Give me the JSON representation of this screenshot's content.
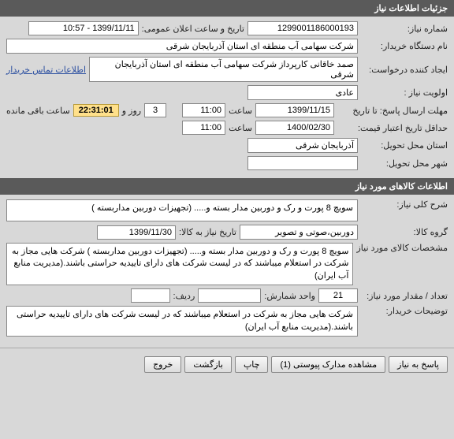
{
  "sections": {
    "need_info_title": "جزئیات اطلاعات نیاز",
    "goods_info_title": "اطلاعات کالاهای مورد نیاز"
  },
  "need": {
    "number_label": "شماره نیاز:",
    "number": "1299001186000193",
    "announce_label": "تاریخ و ساعت اعلان عمومی:",
    "announce_value": "1399/11/11 - 10:57",
    "buyer_org_label": "نام دستگاه خریدار:",
    "buyer_org": "شرکت سهامی آب منطقه ای استان آذربایجان شرقی",
    "requester_label": "ایجاد کننده درخواست:",
    "requester": "صمد خاقانی کارپرداز شرکت سهامی آب منطقه ای استان آذربایجان شرقی",
    "contact_link": "اطلاعات تماس خریدار",
    "priority_label": "اولویت نیاز :",
    "priority": "عادی",
    "deadline_label": "مهلت ارسال پاسخ:  تا تاریخ",
    "deadline_date": "1399/11/15",
    "time_label": "ساعت",
    "deadline_time": "11:00",
    "days_left_prefix": "",
    "days_left": "3",
    "days_left_suffix": "روز و",
    "countdown": "22:31:01",
    "countdown_suffix": "ساعت باقی مانده",
    "validity_label": "حداقل تاریخ اعتبار قیمت:",
    "validity_date": "1400/02/30",
    "validity_time": "11:00",
    "province_label": "استان محل تحویل:",
    "province": "آذربایجان شرقی",
    "city_label": "شهر محل تحویل:",
    "city": ""
  },
  "goods": {
    "desc_label": "شرح کلی نیاز:",
    "desc": "سویچ 8 پورت و رک و دوربین مدار بسته و..... (تجهیزات دوربین مداربسته )",
    "group_label": "گروه کالا:",
    "group": "دوربین،صوتی و تصویر",
    "goods_date_label": "تاریخ نیاز به کالا:",
    "goods_date": "1399/11/30",
    "spec_label": "مشخصات کالای مورد نیاز",
    "spec": "سویچ 8 پورت و رک و دوربین مدار بسته و..... (تجهیزات دوربین مداربسته ) شرکت هایی مجاز به شرکت در استعلام میباشند که در لیست شرکت های دارای تاییدیه حراستی باشند.(مدیریت منابع آب ایران)",
    "qty_label": "تعداد / مقدار مورد نیاز:",
    "qty": "21",
    "unit_label": "واحد شمارش:",
    "unit": "",
    "row_label": "ردیف:",
    "row": "",
    "buyer_notes_label": "توضیحات خریدار:",
    "buyer_notes": "شرکت هایی مجاز به شرکت در استعلام میباشند که در لیست شرکت های دارای تاییدیه حراستی باشند.(مدیریت منابع آب ایران)"
  },
  "buttons": {
    "respond": "پاسخ به نیاز",
    "attachments": "مشاهده مدارک پیوستی  (1)",
    "print": "چاپ",
    "back": "بازگشت",
    "exit": "خروج"
  }
}
